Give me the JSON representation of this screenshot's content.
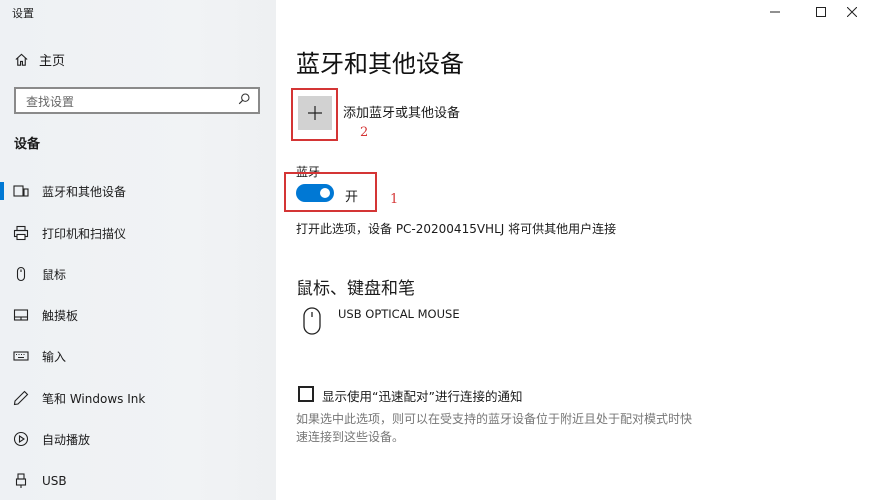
{
  "window": {
    "title": "设置"
  },
  "titlebar": {
    "minimize": "—",
    "maximize": "☐",
    "close": "✕"
  },
  "sidebar": {
    "home_label": "主页",
    "search_placeholder": "查找设置",
    "section_title": "设备",
    "items": [
      {
        "label": "蓝牙和其他设备",
        "icon": "bluetooth-devices-icon",
        "active": true
      },
      {
        "label": "打印机和扫描仪",
        "icon": "printer-icon"
      },
      {
        "label": "鼠标",
        "icon": "mouse-icon"
      },
      {
        "label": "触摸板",
        "icon": "touchpad-icon"
      },
      {
        "label": "输入",
        "icon": "keyboard-icon"
      },
      {
        "label": "笔和 Windows Ink",
        "icon": "pen-icon"
      },
      {
        "label": "自动播放",
        "icon": "autoplay-icon"
      },
      {
        "label": "USB",
        "icon": "usb-icon"
      }
    ]
  },
  "main": {
    "title": "蓝牙和其他设备",
    "add_device_label": "添加蓝牙或其他设备",
    "annotation_add": "2",
    "bluetooth_label": "蓝牙",
    "toggle_text": "开",
    "annotation_toggle": "1",
    "bluetooth_description": "打开此选项，设备 PC-20200415VHLJ 将可供其他用户连接",
    "mouse_section_title": "鼠标、键盘和笔",
    "mouse_device_name": "USB OPTICAL MOUSE",
    "swift_pair_label": "显示使用“迅速配对”进行连接的通知",
    "swift_pair_hint": "如果选中此选项，则可以在受支持的蓝牙设备位于附近且处于配对模式时快速连接到这些设备。",
    "swift_pair_checked": false
  },
  "colors": {
    "accent": "#0078d4",
    "annotation": "#d43535"
  }
}
